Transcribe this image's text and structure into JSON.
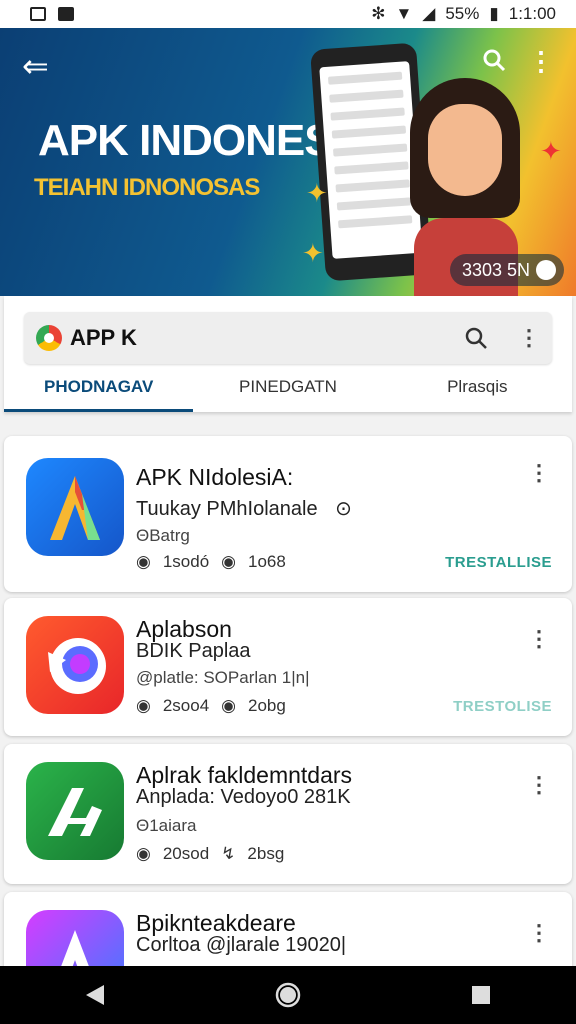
{
  "status_bar": {
    "battery": "55%",
    "time": "1:1:00"
  },
  "banner": {
    "title": "APK INDONESIA",
    "subtitle": "TEIAHN IDNONOSAS",
    "pill": "3303 5N",
    "colors": {
      "dark_blue": "#0b3f74",
      "yellow": "#f4c232",
      "orange": "#ef7a2a"
    }
  },
  "search": {
    "value": "APP K",
    "icon": "search-icon"
  },
  "tabs": [
    {
      "label": "PHODNAGAV",
      "active": true
    },
    {
      "label": "PINEDGATN",
      "active": false
    },
    {
      "label": "Plrasqis",
      "active": false
    }
  ],
  "apps": [
    {
      "name": "APK NIdolesiA:",
      "subtitle": "Tuukay PMhIolanale",
      "meta": "ΘBatrg",
      "stat1": "1sodó",
      "stat2": "1o68",
      "category": "TRESTALLISE"
    },
    {
      "name": "Aplabson",
      "subtitle": "BDIK Paplaa",
      "meta": "@platle: SOParlan 1|n|",
      "stat1": "2soo4",
      "stat2": "2obg",
      "category": "TRESTOLISE"
    },
    {
      "name": "Aplrak fakldemntdars",
      "subtitle": "Anplada: Vedoyo0 281K",
      "meta": "Θ1aiara",
      "stat1": "20sod",
      "stat2": "2bsg",
      "category": ""
    },
    {
      "name": "Bpiknteakdeare",
      "subtitle": "Corltoa @jlarale 19020|",
      "meta": "",
      "stat1": "",
      "stat2": "",
      "category": ""
    }
  ]
}
